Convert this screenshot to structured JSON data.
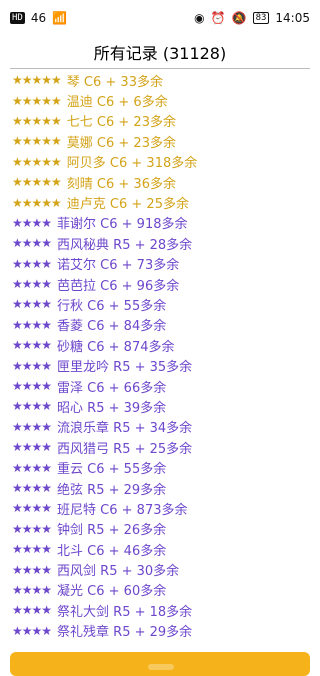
{
  "statusbar": {
    "left_items": [
      "HD",
      "46",
      "wifi"
    ],
    "right_items": [
      "eye",
      "alarm",
      "mute",
      "83",
      "14:05"
    ]
  },
  "header": {
    "title": "所有记录 (31128)"
  },
  "list": {
    "items": [
      {
        "stars": "★★★★★",
        "text": "琴 C6 + 33多余",
        "tone": "gold"
      },
      {
        "stars": "★★★★★",
        "text": "温迪 C6 + 6多余",
        "tone": "gold"
      },
      {
        "stars": "★★★★★",
        "text": "七七 C6 + 23多余",
        "tone": "gold"
      },
      {
        "stars": "★★★★★",
        "text": "莫娜 C6 + 23多余",
        "tone": "gold"
      },
      {
        "stars": "★★★★★",
        "text": "阿贝多 C6 + 318多余",
        "tone": "gold"
      },
      {
        "stars": "★★★★★",
        "text": "刻晴 C6 + 36多余",
        "tone": "gold"
      },
      {
        "stars": "★★★★★",
        "text": "迪卢克 C6 + 25多余",
        "tone": "gold"
      },
      {
        "stars": "★★★★",
        "text": "菲谢尔 C6 + 918多余",
        "tone": "purple"
      },
      {
        "stars": "★★★★",
        "text": "西风秘典 R5 + 28多余",
        "tone": "purple"
      },
      {
        "stars": "★★★★",
        "text": "诺艾尔 C6 + 73多余",
        "tone": "purple"
      },
      {
        "stars": "★★★★",
        "text": "芭芭拉 C6 + 96多余",
        "tone": "purple"
      },
      {
        "stars": "★★★★",
        "text": "行秋 C6 + 55多余",
        "tone": "purple"
      },
      {
        "stars": "★★★★",
        "text": "香菱 C6 + 84多余",
        "tone": "purple"
      },
      {
        "stars": "★★★★",
        "text": "砂糖 C6 + 874多余",
        "tone": "purple"
      },
      {
        "stars": "★★★★",
        "text": "匣里龙吟 R5 + 35多余",
        "tone": "purple"
      },
      {
        "stars": "★★★★",
        "text": "雷泽 C6 + 66多余",
        "tone": "purple"
      },
      {
        "stars": "★★★★",
        "text": "昭心 R5 + 39多余",
        "tone": "purple"
      },
      {
        "stars": "★★★★",
        "text": "流浪乐章 R5 + 34多余",
        "tone": "purple"
      },
      {
        "stars": "★★★★",
        "text": "西风猎弓 R5 + 25多余",
        "tone": "purple"
      },
      {
        "stars": "★★★★",
        "text": "重云 C6 + 55多余",
        "tone": "purple"
      },
      {
        "stars": "★★★★",
        "text": "绝弦 R5 + 29多余",
        "tone": "purple"
      },
      {
        "stars": "★★★★",
        "text": "班尼特 C6 + 873多余",
        "tone": "purple"
      },
      {
        "stars": "★★★★",
        "text": "钟剑 R5 + 26多余",
        "tone": "purple"
      },
      {
        "stars": "★★★★",
        "text": "北斗 C6 + 46多余",
        "tone": "purple"
      },
      {
        "stars": "★★★★",
        "text": "西风剑 R5 + 30多余",
        "tone": "purple"
      },
      {
        "stars": "★★★★",
        "text": "凝光 C6 + 60多余",
        "tone": "purple"
      },
      {
        "stars": "★★★★",
        "text": "祭礼大剑 R5 + 18多余",
        "tone": "purple"
      },
      {
        "stars": "★★★★",
        "text": "祭礼残章 R5 + 29多余",
        "tone": "purple"
      }
    ]
  },
  "colors": {
    "gold": "#d3a318",
    "purple": "#6d47cc",
    "bottom_bar": "#f5b21b"
  }
}
